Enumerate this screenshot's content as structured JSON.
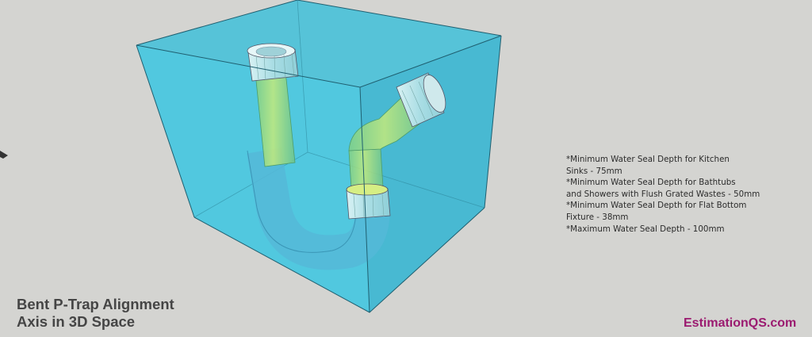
{
  "notes": [
    "*Minimum Water Seal Depth for Kitchen",
    "Sinks - 75mm",
    "*Minimum Water Seal Depth for Bathtubs",
    "and Showers with Flush Grated Wastes - 50mm",
    "*Minimum Water Seal Depth for Flat Bottom",
    "Fixture - 38mm",
    "*Maximum Water Seal Depth - 100mm"
  ],
  "title": {
    "line1": "Bent P-Trap Alignment",
    "line2": "Axis in 3D Space"
  },
  "brand": "EstimationQS.com",
  "colors": {
    "background": "#d4d4d1",
    "water_box": "#3fc2dc",
    "pipe": "#b9e26a",
    "fitting": "#bfe6ea",
    "brand": "#9b1b70",
    "title": "#454545"
  }
}
